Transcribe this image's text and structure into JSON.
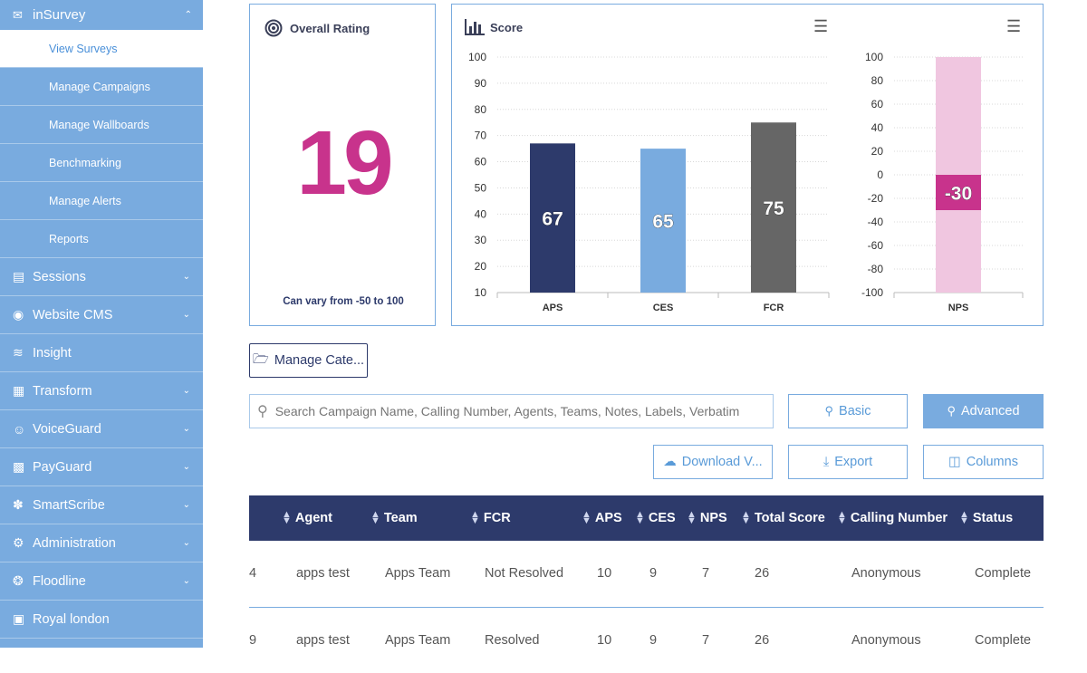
{
  "sidebar": {
    "top": {
      "label": "inSurvey",
      "icon": "chat-icon"
    },
    "subitems": [
      {
        "label": "View Surveys",
        "active": true
      },
      {
        "label": "Manage Campaigns"
      },
      {
        "label": "Manage Wallboards"
      },
      {
        "label": "Benchmarking"
      },
      {
        "label": "Manage Alerts"
      },
      {
        "label": "Reports"
      }
    ],
    "items": [
      {
        "label": "Sessions",
        "icon": "clipboard-icon",
        "chevron": true
      },
      {
        "label": "Website CMS",
        "icon": "globe-icon",
        "chevron": true
      },
      {
        "label": "Insight",
        "icon": "insight-icon",
        "chevron": false
      },
      {
        "label": "Transform",
        "icon": "transform-icon",
        "chevron": true
      },
      {
        "label": "VoiceGuard",
        "icon": "voice-icon",
        "chevron": true
      },
      {
        "label": "PayGuard",
        "icon": "payment-icon",
        "chevron": true
      },
      {
        "label": "SmartScribe",
        "icon": "scribe-icon",
        "chevron": true
      },
      {
        "label": "Administration",
        "icon": "gear-icon",
        "chevron": true
      },
      {
        "label": "Floodline",
        "icon": "lifebuoy-icon",
        "chevron": true
      },
      {
        "label": "Royal london",
        "icon": "briefcase-icon",
        "chevron": false
      }
    ]
  },
  "rating": {
    "title": "Overall Rating",
    "value": "19",
    "note": "Can vary from -50 to 100"
  },
  "score": {
    "title": "Score"
  },
  "chart_data": [
    {
      "type": "bar",
      "categories": [
        "APS",
        "CES",
        "FCR"
      ],
      "values": [
        67,
        65,
        75
      ],
      "colors": [
        "#2d3a6b",
        "#79abdf",
        "#666666"
      ],
      "ylim": [
        10,
        100
      ],
      "yticks": [
        10,
        20,
        30,
        40,
        50,
        60,
        70,
        80,
        90,
        100
      ],
      "data_labels": [
        "67",
        "65",
        "75"
      ]
    },
    {
      "type": "bar",
      "categories": [
        "NPS"
      ],
      "values": [
        -30
      ],
      "colors": [
        "#c8338c"
      ],
      "background_color": "#f0c6e0",
      "ylim": [
        -100,
        100
      ],
      "yticks": [
        -100,
        -80,
        -60,
        -40,
        -20,
        0,
        20,
        40,
        60,
        80,
        100
      ],
      "data_labels": [
        "-30"
      ]
    }
  ],
  "buttons": {
    "manage_categories": "Manage Cate...",
    "basic": "Basic",
    "advanced": "Advanced",
    "download": "Download V...",
    "export": "Export",
    "columns": "Columns"
  },
  "search": {
    "placeholder": "Search Campaign Name, Calling Number, Agents, Teams, Notes, Labels, Verbatim"
  },
  "table": {
    "headers": [
      "Agent",
      "Team",
      "FCR",
      "APS",
      "CES",
      "NPS",
      "Total Score",
      "Calling Number",
      "Status"
    ],
    "rows": [
      {
        "id": "4",
        "agent": "apps test",
        "team": "Apps Team",
        "fcr": "Not Resolved",
        "aps": "10",
        "ces": "9",
        "nps": "7",
        "total": "26",
        "calling": "Anonymous",
        "status": "Complete"
      },
      {
        "id": "9",
        "agent": "apps test",
        "team": "Apps Team",
        "fcr": "Resolved",
        "aps": "10",
        "ces": "9",
        "nps": "7",
        "total": "26",
        "calling": "Anonymous",
        "status": "Complete"
      }
    ]
  }
}
